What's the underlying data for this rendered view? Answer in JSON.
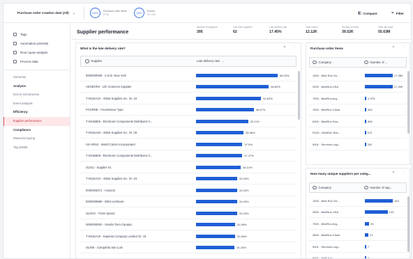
{
  "header": {
    "filter_label": "Purchase order creation date (All)",
    "chev": "⌄",
    "kpi1_ring": "100%",
    "kpi1_label": "Purchase order items",
    "kpi1_sub": "37.5K",
    "kpi2_ring": "100%",
    "kpi2_label": "Events",
    "kpi2_sub": "470.11K",
    "compare_label": "Compare",
    "filter_btn_label": "Filter"
  },
  "sidebar": {
    "top_items": [
      {
        "label": "Tags"
      },
      {
        "label": "Automation potential"
      },
      {
        "label": "Root cause analysis"
      },
      {
        "label": "Process data"
      }
    ],
    "nav": [
      {
        "label": "Summary",
        "type": "item"
      },
      {
        "label": "Analysis",
        "type": "head"
      },
      {
        "label": "End to end process",
        "type": "item"
      },
      {
        "label": "Event analysis",
        "type": "item"
      },
      {
        "label": "Efficiency",
        "type": "head"
      },
      {
        "label": "Supplier performance",
        "type": "item",
        "active": true
      },
      {
        "label": "Compliance",
        "type": "head"
      },
      {
        "label": "Maverick buying",
        "type": "item"
      },
      {
        "label": "Tag details",
        "type": "item"
      }
    ]
  },
  "page": {
    "title": "Supplier performance",
    "kpis": [
      {
        "label": "Number of suppliers",
        "value": "395"
      },
      {
        "label": "One time suppliers",
        "value": "62"
      },
      {
        "label": "Late delivery rate",
        "value": "17.45%"
      },
      {
        "label": "Total orders",
        "value": "12.12K"
      },
      {
        "label": "Number of items",
        "value": "39.52K"
      },
      {
        "label": "Total net value",
        "value": "55.63M"
      }
    ]
  },
  "late_panel": {
    "title": "What is the late delivery rate?",
    "col_supplier": "Supplier",
    "col_rate": "Late delivery rate",
    "rows": [
      {
        "name": "0000000008 - C.E.B. New York",
        "pct": 66.03,
        "label": "66.03%"
      },
      {
        "name": "VENDOR4 - Life Sciences Supplier",
        "pct": 58.82,
        "label": "58.82%"
      },
      {
        "name": "T-K515A10 - Abbot Supplies Inc. Gr. 10",
        "pct": 52.63,
        "label": "52.63%"
      },
      {
        "name": "FOURNE - Fournisseur Type",
        "pct": 46.67,
        "label": "46.67%"
      },
      {
        "name": "T-K515B05 - Electronic Components Distributor 0...",
        "pct": 42.11,
        "label": "42.11%"
      },
      {
        "name": "T-K515A29 - Abbot Supplies Inc. Gr. 29",
        "pct": 38.46,
        "label": "38.46%"
      },
      {
        "name": "US-VEN2 - World Colors Incorporated",
        "pct": 37.5,
        "label": "37.5%"
      },
      {
        "name": "T-K515B08 - Electronic Components Distributor 0...",
        "pct": 37.27,
        "label": "37.27%"
      },
      {
        "name": "SL011 - Supplier 01",
        "pct": 36.21,
        "label": "36.21%"
      },
      {
        "name": "T-K515A23 - Abbot Supplies Inc. Gr. 23",
        "pct": 33.33,
        "label": "33.33%"
      },
      {
        "name": "0000003371 - Amazon",
        "pct": 33.33,
        "label": "33.33%"
      },
      {
        "name": "0000009999 - IDES Lieferant",
        "pct": 33.33,
        "label": "33.33%"
      },
      {
        "name": "SLOG2 - Trans Speed",
        "pct": 33.33,
        "label": "33.33%"
      },
      {
        "name": "0000000002 - Vendor from Canada",
        "pct": 31.58,
        "label": "31.58%"
      },
      {
        "name": "T-K515A19 - Sapsota Company Limited Gr. 19",
        "pct": 31.58,
        "label": "31.58%"
      },
      {
        "name": "SL006 - Compañía San Luis",
        "pct": 31.25,
        "label": "31.25%"
      }
    ]
  },
  "po_panel": {
    "title": "Purchase order items",
    "col_company": "Company",
    "col_num": "Number of ...",
    "rows": [
      {
        "name": "1000 - Best Run Ge...",
        "value": 17380,
        "label": "17,38K"
      },
      {
        "name": "3000 - BestRun USA",
        "value": 17280,
        "label": "17,28K"
      },
      {
        "name": "7500 - BestRun Arg...",
        "value": 1070,
        "label": "1.07K"
      },
      {
        "name": "7600 - BestRun China",
        "value": 900,
        "label": "900"
      },
      {
        "name": "8300 - BestRun Rus...",
        "value": 838,
        "label": "838"
      },
      {
        "name": "R100 - BestRun Res...",
        "value": 470,
        "label": "470"
      },
      {
        "name": "5001 - Services Logi...",
        "value": 332,
        "label": "332"
      }
    ]
  },
  "unique_panel": {
    "title": "How many unique suppliers per categ...",
    "col_company": "Company",
    "col_num": "Number of sup...",
    "rows": [
      {
        "name": "1000 - Best Run Ge...",
        "value": 163,
        "label": "163"
      },
      {
        "name": "3000 - BestRun USA",
        "value": 133,
        "label": "133"
      },
      {
        "name": "7500 - BestRun Arg...",
        "value": 24,
        "label": "24"
      },
      {
        "name": "3800 - BestRun China",
        "value": 21,
        "label": "21"
      },
      {
        "name": "5001 - Services Logi...",
        "value": 7,
        "label": "7"
      },
      {
        "name": "0001 - SAP A.G.",
        "value": 7,
        "label": "7"
      }
    ]
  }
}
